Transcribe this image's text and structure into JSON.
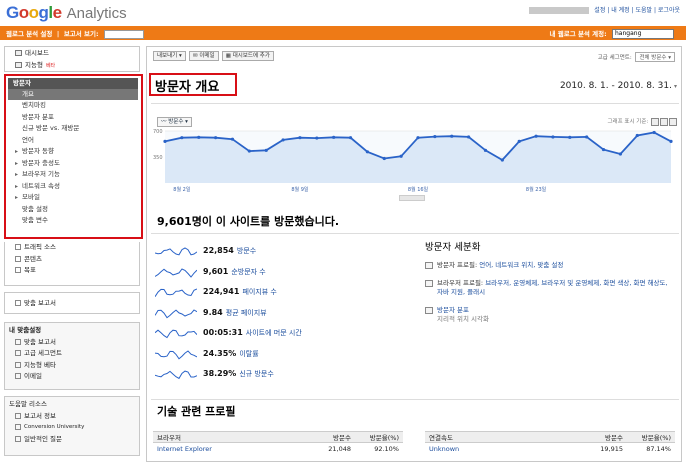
{
  "header": {
    "logo_google": [
      "G",
      "o",
      "o",
      "g",
      "l",
      "e"
    ],
    "logo_analytics": "Analytics",
    "links": [
      "설정",
      "내 계정",
      "도움말",
      "로그아웃"
    ]
  },
  "orange_bar": {
    "back_link": "웹로그 분석 설정",
    "report_label": "보고서 보기:",
    "my_account_label": "내 웹로그 분석 계정:",
    "account_value": "hangang"
  },
  "sidebar": {
    "top_items": [
      {
        "label": "대시보드",
        "icon": "dashboard-icon"
      },
      {
        "label": "지능형",
        "icon": "intelligence-icon",
        "badge": "베타"
      }
    ],
    "visitors": {
      "header": "방문자",
      "selected": "개요",
      "items": [
        {
          "label": "벤치마킹",
          "arrow": false
        },
        {
          "label": "방문자 분포",
          "arrow": false
        },
        {
          "label": "신규 방문 vs. 재방문",
          "arrow": false
        },
        {
          "label": "언어",
          "arrow": false
        },
        {
          "label": "방문자 동향",
          "arrow": true
        },
        {
          "label": "방문자 충성도",
          "arrow": true
        },
        {
          "label": "브라우저 기능",
          "arrow": true
        },
        {
          "label": "네트워크 속성",
          "arrow": true
        },
        {
          "label": "모바일",
          "arrow": true
        },
        {
          "label": "맞춤 설정",
          "arrow": false
        },
        {
          "label": "맞춤 변수",
          "arrow": false
        }
      ]
    },
    "more_sections": [
      "트래픽 소스",
      "콘텐츠",
      "목표"
    ],
    "custom_reports": "맞춤 보고서",
    "my_custom": {
      "title": "내 맞춤설정",
      "items": [
        "맞춤 보고서",
        "고급 세그먼트",
        "지능형 베타",
        "이메일"
      ]
    },
    "help": {
      "title": "도움말 리소스",
      "items": [
        "보고서 정보",
        "Conversion University",
        "일반적인 질문"
      ]
    }
  },
  "toolbar": {
    "buttons": [
      "내보내기 ▾",
      "이메일",
      "대시보드에 추가"
    ],
    "segment_label": "고급 세그먼트:",
    "segment_value": "전체 방문수 ▾"
  },
  "page": {
    "title": "방문자 개요",
    "date_range": "2010. 8. 1. - 2010. 8. 31.",
    "metric_selector": "방문수 ▾",
    "graph_mode_label": "그래프 표시 기준:"
  },
  "chart_data": {
    "type": "line",
    "x": [
      "8월 1일",
      "8월 2일",
      "8월 3일",
      "8월 4일",
      "8월 5일",
      "8월 6일",
      "8월 7일",
      "8월 8일",
      "8월 9일",
      "8월 10일",
      "8월 11일",
      "8월 12일",
      "8월 13일",
      "8월 14일",
      "8월 15일",
      "8월 16일",
      "8월 17일",
      "8월 18일",
      "8월 19일",
      "8월 20일",
      "8월 21일",
      "8월 22일",
      "8월 23일",
      "8월 24일",
      "8월 25일",
      "8월 26일",
      "8월 27일",
      "8월 28일",
      "8월 29일",
      "8월 30일",
      "8월 31일"
    ],
    "series": [
      {
        "values": [
          560,
          610,
          615,
          610,
          590,
          430,
          440,
          580,
          610,
          605,
          615,
          610,
          420,
          330,
          360,
          610,
          625,
          630,
          620,
          440,
          310,
          560,
          630,
          620,
          615,
          620,
          450,
          390,
          640,
          680,
          560
        ]
      }
    ],
    "ylim": [
      0,
      700
    ],
    "y_ticks": [
      350,
      700
    ],
    "x_tick_labels": [
      "8월 2일",
      "8월 9일",
      "8월 16일",
      "8월 23일"
    ],
    "grid": true
  },
  "summary": {
    "headline": "9,601명이 이 사이트를 방문했습니다.",
    "stats": [
      {
        "value": "22,854",
        "label": "방문수"
      },
      {
        "value": "9,601",
        "label": "순방문자 수"
      },
      {
        "value": "224,941",
        "label": "페이지뷰 수"
      },
      {
        "value": "9.84",
        "label": "평균 페이지뷰"
      },
      {
        "value": "00:05:31",
        "label": "사이트에 머문 시간"
      },
      {
        "value": "24.35%",
        "label": "이탈률"
      },
      {
        "value": "38.29%",
        "label": "신규 방문수"
      }
    ]
  },
  "segmentation": {
    "title": "방문자 세분화",
    "rows": [
      {
        "icon": "user-icon",
        "prefix": "방문자 프로필:",
        "links": "언어, 네트워크 위치, 맞춤 설정",
        "note": ""
      },
      {
        "icon": "browser-icon",
        "prefix": "브라우저 프로필:",
        "links": "브라우저, 운영체제, 브라우저 및 운영체제, 화면 색상, 화면 해상도, 자바 지원, 플래시",
        "note": ""
      },
      {
        "icon": "globe-icon",
        "prefix": "",
        "links": "방문자 분포",
        "note": "지리적 위치 시각화"
      }
    ]
  },
  "tech": {
    "title": "기술 관련 프로필",
    "browser_table": {
      "headers": [
        "브라우저",
        "방문수",
        "방문율(%)"
      ],
      "rows": [
        [
          "Internet Explorer",
          "21,048",
          "92.10%"
        ]
      ]
    },
    "connection_table": {
      "headers": [
        "연결속도",
        "방문수",
        "방문율(%)"
      ],
      "rows": [
        [
          "Unknown",
          "19,915",
          "87.14%"
        ]
      ]
    }
  },
  "colors": {
    "accent_orange": "#ee7a16",
    "highlight_red": "#d80f16",
    "line_blue": "#2a63c8",
    "area_blue": "#dbe8f7",
    "link_blue": "#1a4c9c"
  }
}
